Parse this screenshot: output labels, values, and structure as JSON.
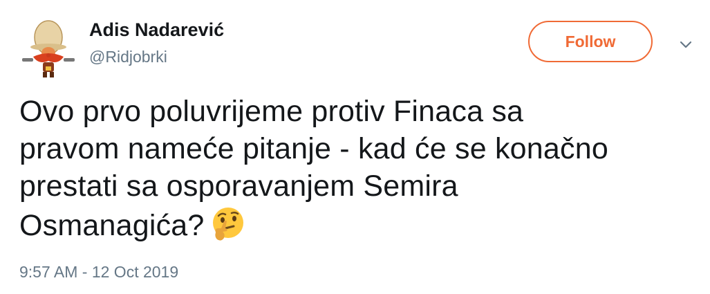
{
  "user": {
    "name": "Adis Nadarević",
    "handle": "@Ridjobrki"
  },
  "follow": {
    "label": "Follow",
    "accent_color": "#f06a35"
  },
  "tweet": {
    "lines": [
      "Ovo prvo poluvrijeme protiv Finaca sa",
      "pravom nameće pitanje - kad će se konačno",
      "prestati sa osporavanjem Semira",
      "Osmanagića?"
    ],
    "emoji": "thinking-face-icon",
    "timestamp": "9:57 AM - 12 Oct 2019"
  },
  "icons": {
    "avatar": "cartoon-cowboy-avatar",
    "menu": "chevron-down-icon"
  }
}
